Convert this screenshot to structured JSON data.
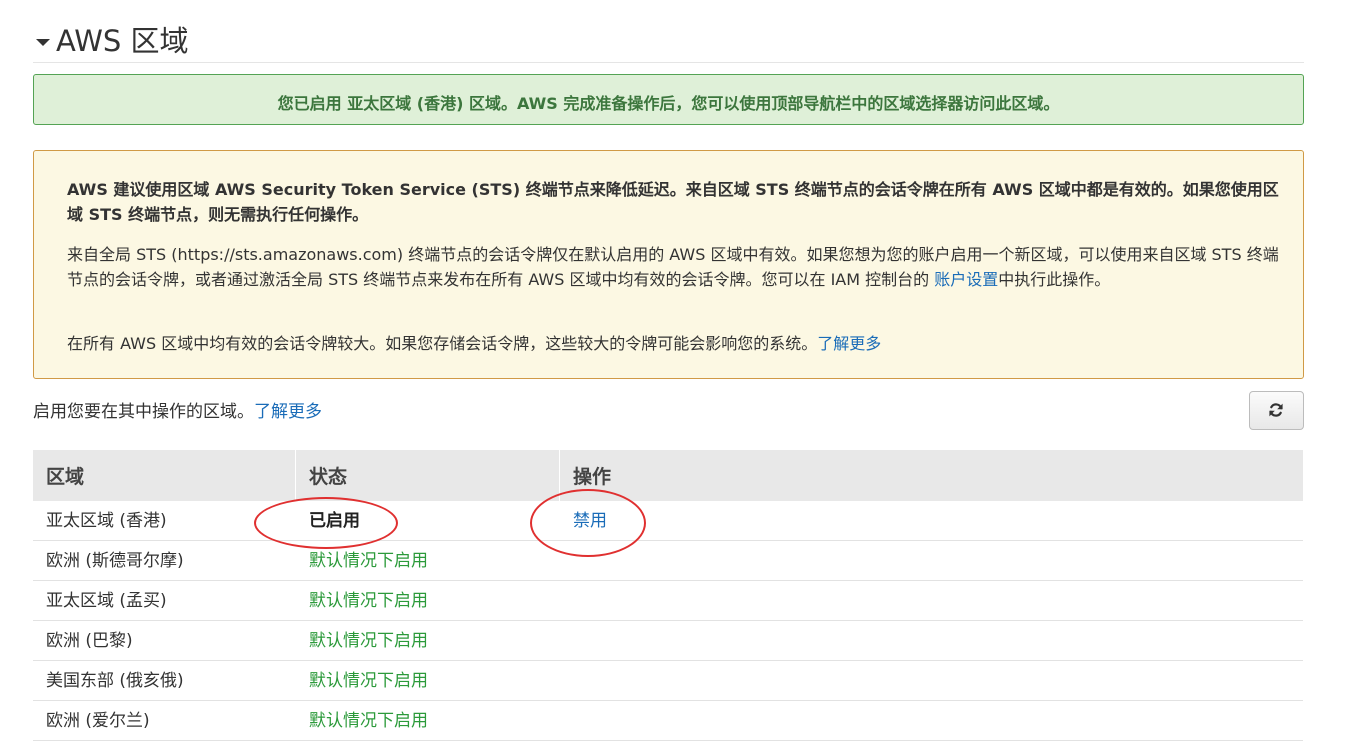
{
  "section": {
    "title": "AWS 区域"
  },
  "success_banner": {
    "text": "您已启用 亚太区域 (香港) 区域。AWS 完成准备操作后，您可以使用顶部导航栏中的区域选择器访问此区域。"
  },
  "warning": {
    "paragraph1": "AWS 建议使用区域 AWS Security Token Service (STS) 终端节点来降低延迟。来自区域 STS 终端节点的会话令牌在所有 AWS 区域中都是有效的。如果您使用区域 STS 终端节点，则无需执行任何操作。",
    "paragraph2_before": "来自全局 STS (https://sts.amazonaws.com) 终端节点的会话令牌仅在默认启用的 AWS 区域中有效。如果您想为您的账户启用一个新区域，可以使用来自区域 STS 终端节点的会话令牌，或者通过激活全局 STS 终端节点来发布在所有 AWS 区域中均有效的会话令牌。您可以在 IAM 控制台的 ",
    "paragraph2_link": "账户设置",
    "paragraph2_after": "中执行此操作。",
    "paragraph3_before": "在所有 AWS 区域中均有效的会话令牌较大。如果您存储会话令牌，这些较大的令牌可能会影响您的系统。",
    "paragraph3_link": "了解更多"
  },
  "intro": {
    "text": "启用您要在其中操作的区域。",
    "link": "了解更多"
  },
  "refresh_button": {
    "icon": "refresh-icon"
  },
  "table": {
    "headers": [
      "区域",
      "状态",
      "操作"
    ],
    "rows": [
      {
        "region": "亚太区域 (香港)",
        "status": "已启用",
        "action": "禁用"
      },
      {
        "region": "欧洲 (斯德哥尔摩)",
        "status": "默认情况下启用",
        "action": ""
      },
      {
        "region": "亚太区域 (孟买)",
        "status": "默认情况下启用",
        "action": ""
      },
      {
        "region": "欧洲 (巴黎)",
        "status": "默认情况下启用",
        "action": ""
      },
      {
        "region": "美国东部 (俄亥俄)",
        "status": "默认情况下启用",
        "action": ""
      },
      {
        "region": "欧洲 (爱尔兰)",
        "status": "默认情况下启用",
        "action": ""
      }
    ]
  },
  "colors": {
    "link": "#1a6cb8",
    "success_text": "#3c763d",
    "default_enabled": "#2b9a3a",
    "annotation": "#e03030"
  }
}
